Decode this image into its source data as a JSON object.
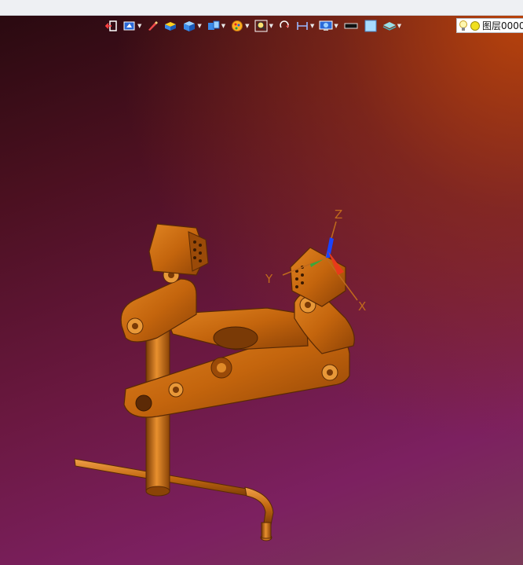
{
  "window": {
    "background_top": "#eef0f3"
  },
  "viewport": {
    "gradient": [
      "#2a0a10",
      "#6a1840",
      "#7a3a58",
      "#be4610"
    ],
    "model_color": "#c8660e"
  },
  "toolbar": {
    "buttons": [
      {
        "icon": "exit-view-icon",
        "has_dropdown": false
      },
      {
        "icon": "view-orient-icon",
        "has_dropdown": true
      },
      {
        "icon": "pencil-sketch-icon",
        "has_dropdown": false
      },
      {
        "icon": "display-style-icon",
        "has_dropdown": false
      },
      {
        "icon": "shaded-cube-icon",
        "has_dropdown": true
      },
      {
        "icon": "section-view-icon",
        "has_dropdown": true
      },
      {
        "icon": "appearance-icon",
        "has_dropdown": true
      },
      {
        "icon": "zoom-fit-icon",
        "has_dropdown": true
      },
      {
        "icon": "rotate-view-icon",
        "has_dropdown": false
      },
      {
        "icon": "measure-icon",
        "has_dropdown": true
      },
      {
        "icon": "monitor-view-icon",
        "has_dropdown": true
      },
      {
        "icon": "black-swatch-icon",
        "has_dropdown": false
      },
      {
        "icon": "light-blue-swatch-icon",
        "has_dropdown": false
      },
      {
        "icon": "layer-stack-icon",
        "has_dropdown": true
      }
    ]
  },
  "layer": {
    "label": "图层0000"
  },
  "axes": {
    "x": "X",
    "y": "Y",
    "z": "Z"
  }
}
